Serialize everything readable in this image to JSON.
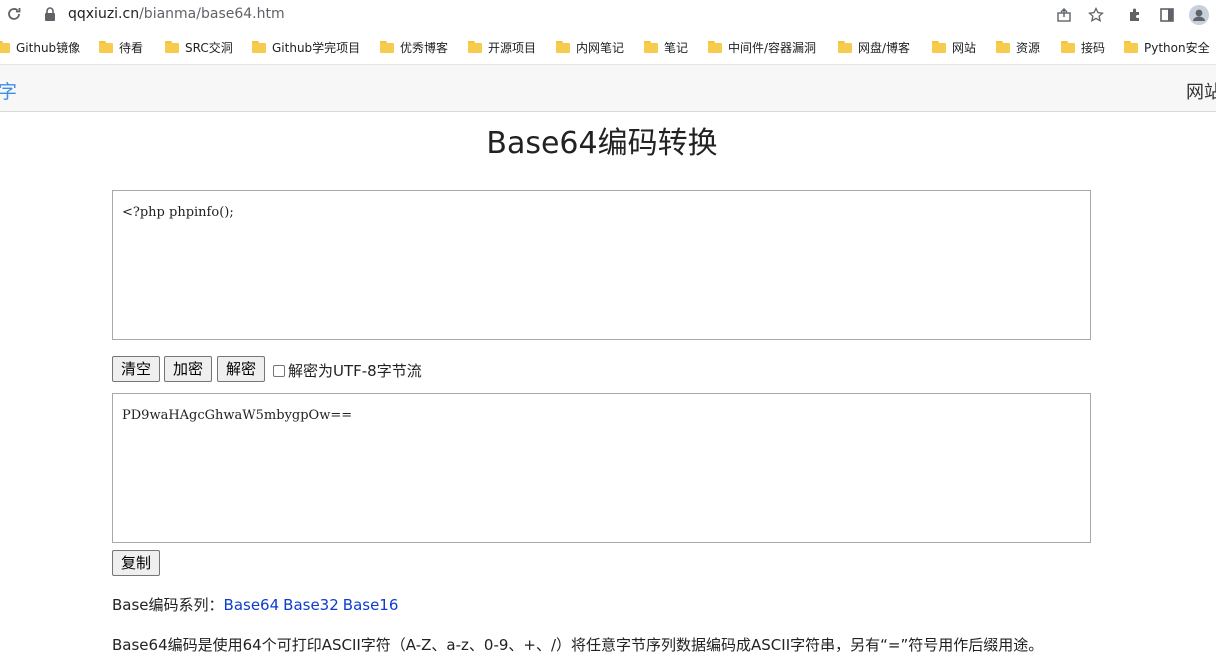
{
  "browser": {
    "url_host": "qqxiuzi.cn",
    "url_path": "/bianma/base64.htm",
    "icons": [
      "reload-icon",
      "lock-icon",
      "share-icon",
      "star-icon",
      "extensions-icon",
      "side-panel-icon",
      "profile-icon"
    ]
  },
  "bookmarks": [
    {
      "label": "Github镜像"
    },
    {
      "label": "待看"
    },
    {
      "label": "SRC交洞"
    },
    {
      "label": "Github学完项目"
    },
    {
      "label": "优秀博客"
    },
    {
      "label": "开源项目"
    },
    {
      "label": "内网笔记"
    },
    {
      "label": "笔记"
    },
    {
      "label": "中间件/容器漏洞"
    },
    {
      "label": "网盘/博客"
    },
    {
      "label": "网站"
    },
    {
      "label": "资源"
    },
    {
      "label": "接码"
    },
    {
      "label": "Python安全"
    }
  ],
  "site": {
    "logo_text": "字",
    "nav_text": "网站"
  },
  "page": {
    "title": "Base64编码转换",
    "input_text": "<?php phpinfo();",
    "output_text": "PD9waHAgcGhwaW5mbygpOw==",
    "buttons": {
      "clear": "清空",
      "encode": "加密",
      "decode": "解密",
      "copy": "复制"
    },
    "utf8_label": "解密为UTF-8字节流",
    "utf8_checked": false,
    "series_label": "Base编码系列：",
    "series_links": [
      "Base64",
      "Base32",
      "Base16"
    ],
    "description": "Base64编码是使用64个可打印ASCII字符（A-Z、a-z、0-9、+、/）将任意字节序列数据编码成ASCII字符串，另有“=”符号用作后缀用途。"
  },
  "colors": {
    "link": "#0b3ccf",
    "logo": "#3f8ee8",
    "folder": "#f7cb4d"
  }
}
